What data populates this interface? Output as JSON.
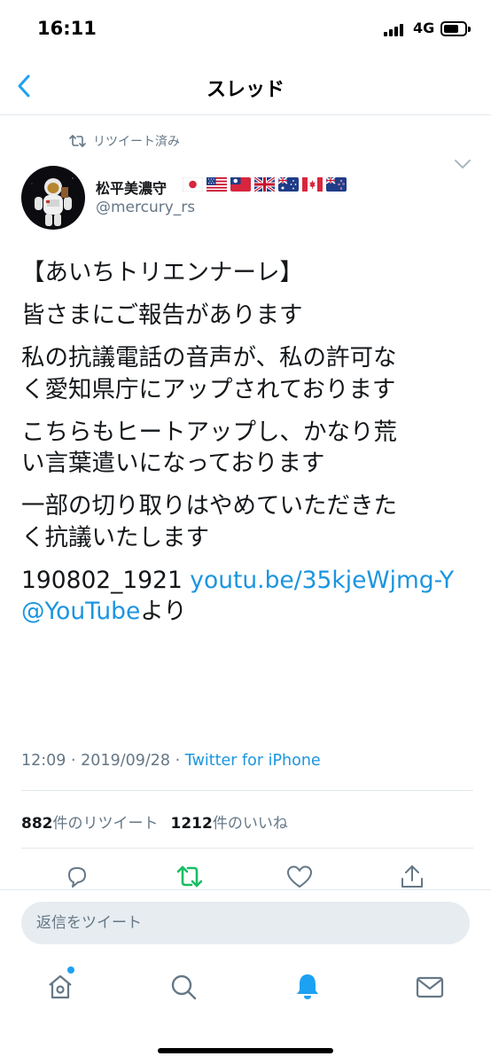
{
  "status_bar": {
    "time": "16:11",
    "network": "4G"
  },
  "nav": {
    "title": "スレッド"
  },
  "retweet_context": {
    "label": "リツイート済み"
  },
  "author": {
    "name": "松平美濃守",
    "handle": "@mercury_rs",
    "flags": [
      "Japan",
      "United States",
      "Taiwan",
      "United Kingdom",
      "Australia",
      "Canada",
      "New Zealand"
    ]
  },
  "tweet": {
    "lines": [
      "【あいちトリエンナーレ】",
      "皆さまにご報告があります",
      "私の抗議電話の音声が、私の許可な",
      "く愛知県庁にアップされております",
      "こちらもヒートアップし、かなり荒",
      "い言葉遣いになっております",
      "一部の切り取りはやめていただきた",
      "く抗議いたします"
    ],
    "video_id": "190802_1921",
    "link": "youtu.be/35kjeWjmg-Y",
    "mention": "@YouTube",
    "mention_suffix": "より"
  },
  "meta": {
    "time": "12:09",
    "separator": "·",
    "date": "2019/09/28",
    "source": "Twitter for iPhone"
  },
  "stats": {
    "retweet_count": "882",
    "retweet_label": "件のリツイート",
    "like_count": "1212",
    "like_label": "件のいいね"
  },
  "reply": {
    "placeholder": "返信をツイート"
  },
  "colors": {
    "accent": "#1da1f2",
    "link": "#1b95e0",
    "retweet_active": "#17bf63",
    "secondary_text": "#657786",
    "divider": "#e1e8ed",
    "reply_background": "#e6ecf0"
  },
  "icons": {
    "back": "chevron-left-icon",
    "caret": "chevron-down-icon",
    "retweet_context": "retweet-icon",
    "reply": "reply-icon",
    "retweet": "retweet-icon",
    "like": "heart-icon",
    "share": "share-icon",
    "tab_home": "home-icon",
    "tab_search": "search-icon",
    "tab_notifications": "bell-icon",
    "tab_messages": "mail-icon"
  }
}
